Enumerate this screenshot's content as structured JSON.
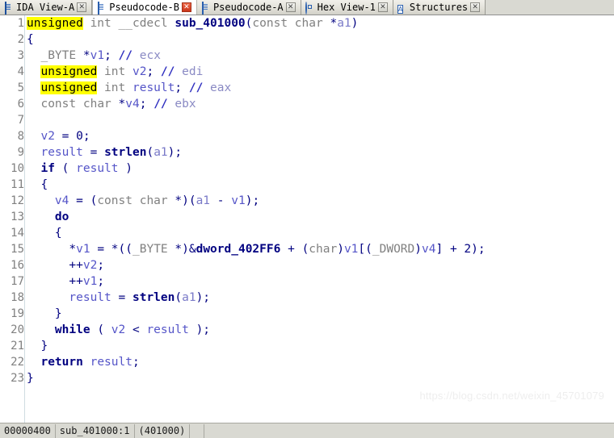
{
  "window": {
    "app": "IDA Pro",
    "view": "Pseudocode-B"
  },
  "tabs": [
    {
      "label": "IDA View-A",
      "icon": "ida-view-icon",
      "active": false,
      "close_label": "✕",
      "close_style": "gray"
    },
    {
      "label": "Pseudocode-B",
      "icon": "pseudocode-icon",
      "active": true,
      "close_label": "✕",
      "close_style": "red"
    },
    {
      "label": "Pseudocode-A",
      "icon": "pseudocode-icon",
      "active": false,
      "close_label": "✕",
      "close_style": "gray"
    },
    {
      "label": "Hex View-1",
      "icon": "hex-view-icon",
      "active": false,
      "close_label": "✕",
      "close_style": "gray"
    },
    {
      "label": "Structures",
      "icon": "structures-icon",
      "active": false,
      "close_label": "✕",
      "close_style": "gray"
    }
  ],
  "code": {
    "highlight_token": "unsigned",
    "highlight_color": "#ffff00",
    "lines": [
      {
        "n": "1",
        "text": "unsigned int __cdecl sub_401000(const char *a1)"
      },
      {
        "n": "2",
        "text": "{"
      },
      {
        "n": "3",
        "text": "  _BYTE *v1; // ecx"
      },
      {
        "n": "4",
        "text": "  unsigned int v2; // edi"
      },
      {
        "n": "5",
        "text": "  unsigned int result; // eax"
      },
      {
        "n": "6",
        "text": "  const char *v4; // ebx"
      },
      {
        "n": "7",
        "text": ""
      },
      {
        "n": "8",
        "text": "  v2 = 0;"
      },
      {
        "n": "9",
        "text": "  result = strlen(a1);"
      },
      {
        "n": "10",
        "text": "  if ( result )"
      },
      {
        "n": "11",
        "text": "  {"
      },
      {
        "n": "12",
        "text": "    v4 = (const char *)(a1 - v1);"
      },
      {
        "n": "13",
        "text": "    do"
      },
      {
        "n": "14",
        "text": "    {"
      },
      {
        "n": "15",
        "text": "      *v1 = *((_BYTE *)&dword_402FF6 + (char)v1[(_DWORD)v4] + 2);"
      },
      {
        "n": "16",
        "text": "      ++v2;"
      },
      {
        "n": "17",
        "text": "      ++v1;"
      },
      {
        "n": "18",
        "text": "      result = strlen(a1);"
      },
      {
        "n": "19",
        "text": "    }"
      },
      {
        "n": "20",
        "text": "    while ( v2 < result );"
      },
      {
        "n": "21",
        "text": "  }"
      },
      {
        "n": "22",
        "text": "  return result;"
      },
      {
        "n": "23",
        "text": "}"
      }
    ]
  },
  "watermark": {
    "text": "https://blog.csdn.net/weixin_45701079"
  },
  "statusbar": {
    "offset": "00000400",
    "location": "sub_401000:1",
    "address": "(401000)"
  }
}
